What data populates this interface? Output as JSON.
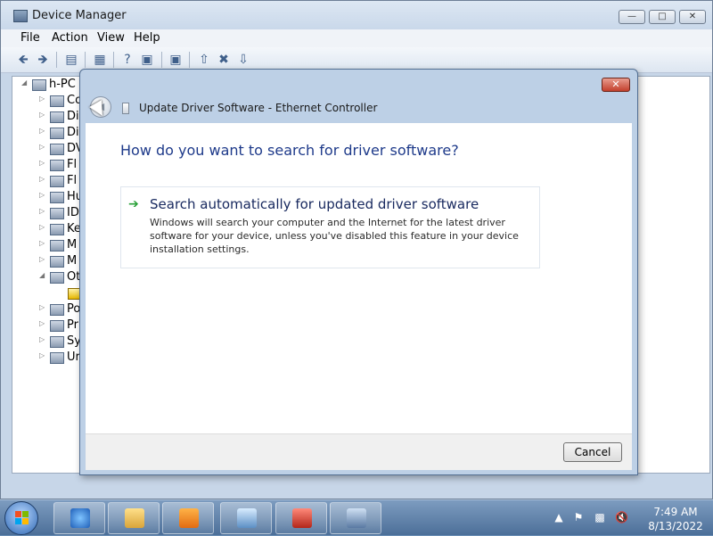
{
  "window": {
    "title": "Device Manager",
    "minimize_icon": "minimize-icon",
    "maximize_icon": "maximize-icon",
    "close_icon": "close-icon"
  },
  "menu": [
    "File",
    "Action",
    "View",
    "Help"
  ],
  "toolbar": {
    "icons": [
      "back-icon",
      "forward-icon",
      "show-hide-tree-icon",
      "properties-icon",
      "help-icon",
      "view-icon",
      "scan-hardware-icon",
      "update-driver-icon",
      "uninstall-icon",
      "disable-icon"
    ]
  },
  "tree": {
    "root": "h-PC",
    "items": [
      {
        "label": "Co",
        "icon": "computer-icon"
      },
      {
        "label": "Di",
        "icon": "disk-drives-icon"
      },
      {
        "label": "Di",
        "icon": "display-adapters-icon"
      },
      {
        "label": "DV",
        "icon": "dvd-drive-icon"
      },
      {
        "label": "Fl",
        "icon": "floppy-controller-icon"
      },
      {
        "label": "Fl",
        "icon": "floppy-drive-icon"
      },
      {
        "label": "Hu",
        "icon": "hid-icon"
      },
      {
        "label": "ID",
        "icon": "ide-controller-icon"
      },
      {
        "label": "Ke",
        "icon": "keyboard-icon"
      },
      {
        "label": "M",
        "icon": "mouse-icon"
      },
      {
        "label": "M",
        "icon": "monitor-icon"
      },
      {
        "label": "Ot",
        "icon": "other-devices-icon"
      },
      {
        "label": "",
        "icon": "warning-device-icon"
      },
      {
        "label": "Po",
        "icon": "ports-icon"
      },
      {
        "label": "Pr",
        "icon": "processor-icon"
      },
      {
        "label": "Sy",
        "icon": "system-devices-icon"
      },
      {
        "label": "Ur",
        "icon": "usb-controller-icon"
      }
    ]
  },
  "dialog": {
    "title": "Update Driver Software - Ethernet Controller",
    "question": "How do you want to search for driver software?",
    "option": {
      "title": "Search automatically for updated driver software",
      "description": "Windows will search your computer and the Internet for the latest driver software for your device, unless you've disabled this feature in your device installation settings."
    },
    "cancel_label": "Cancel",
    "close_icon": "close-icon",
    "back_icon": "back-arrow-icon"
  },
  "taskbar": {
    "tasks": [
      "internet-explorer-icon",
      "windows-explorer-icon",
      "media-player-icon",
      "control-panel-icon",
      "toolbox-icon",
      "device-manager-icon"
    ],
    "clock_time": "7:49 AM",
    "clock_date": "8/13/2022"
  }
}
